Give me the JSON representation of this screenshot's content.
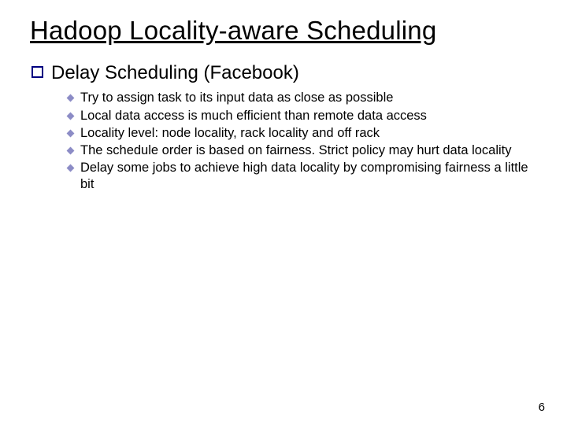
{
  "title": "Hadoop Locality-aware Scheduling",
  "heading": "Delay Scheduling (Facebook)",
  "bullets": [
    "Try to assign task to its input data as close as possible",
    "Local data access is much efficient than remote data access",
    "Locality level: node locality, rack locality and off rack",
    "The schedule order is based on fairness. Strict policy may hurt data locality",
    "Delay some jobs to achieve high data locality by compromising fairness a little bit"
  ],
  "page_number": "6"
}
